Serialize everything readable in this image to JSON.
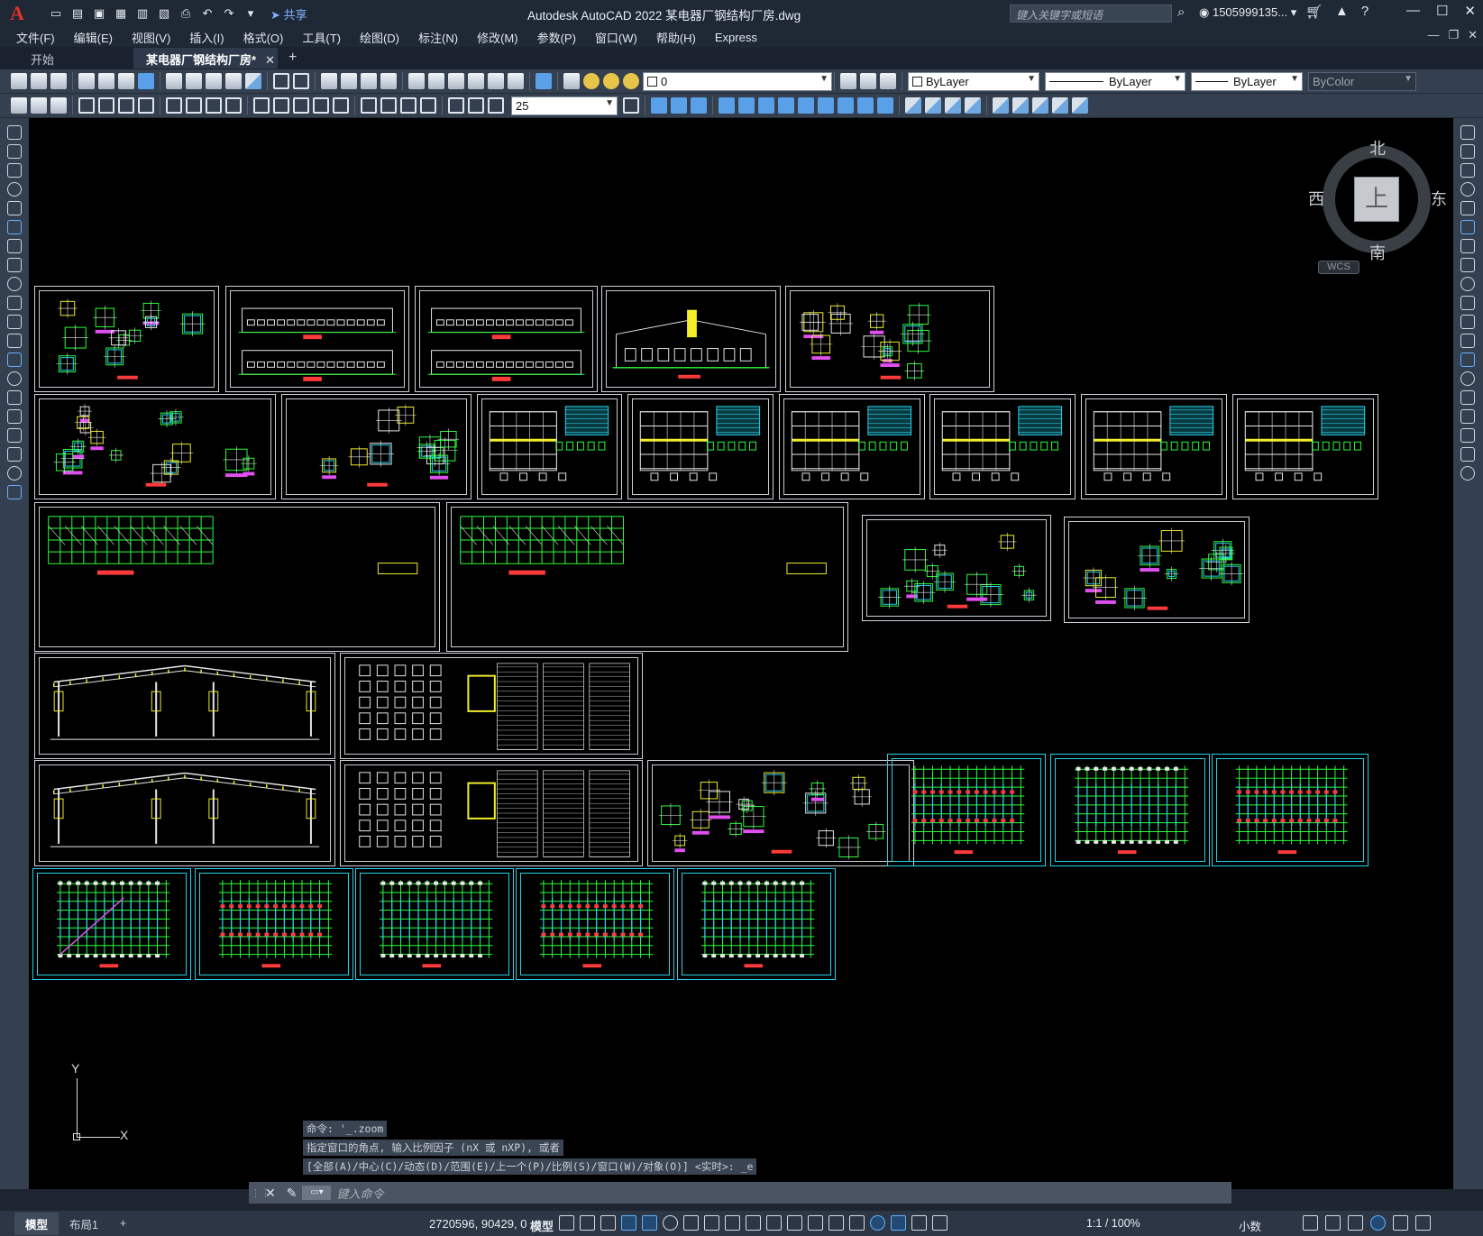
{
  "app": {
    "logo_letter": "A",
    "title": "Autodesk AutoCAD 2022    某电器厂钢结构厂房.dwg",
    "share_label": "共享",
    "search_placeholder": "键入关键字或短语",
    "user": "1505999135...",
    "accent_color": "#e0322e"
  },
  "menu": {
    "items": [
      "文件(F)",
      "编辑(E)",
      "视图(V)",
      "插入(I)",
      "格式(O)",
      "工具(T)",
      "绘图(D)",
      "标注(N)",
      "修改(M)",
      "参数(P)",
      "窗口(W)",
      "帮助(H)",
      "Express"
    ]
  },
  "tabs": {
    "start": "开始",
    "active": "某电器厂钢结构厂房*",
    "close_glyph": "✕",
    "add_glyph": "+"
  },
  "toolbar": {
    "layer_value": "0",
    "color_value": "ByLayer",
    "linetype_value": "ByLayer",
    "lineweight_value": "ByLayer",
    "plotstyle_value": "ByColor",
    "dimscale_value": "25"
  },
  "viewcube": {
    "north": "北",
    "south": "南",
    "east": "东",
    "west": "西",
    "face": "上",
    "wcs": "WCS"
  },
  "ucs": {
    "x_label": "X",
    "y_label": "Y"
  },
  "command": {
    "history": [
      "命令: '_.zoom",
      "指定窗口的角点, 输入比例因子 (nX 或 nXP), 或者",
      "[全部(A)/中心(C)/动态(D)/范围(E)/上一个(P)/比例(S)/窗口(W)/对象(O)] <实时>: _e"
    ],
    "placeholder": "键入命令"
  },
  "status": {
    "model_tab": "模型",
    "layout_tab": "布局1",
    "coords": "2720596, 90429, 0",
    "model_label": "模型",
    "scale": "1:1 / 100%",
    "units": "小数"
  }
}
